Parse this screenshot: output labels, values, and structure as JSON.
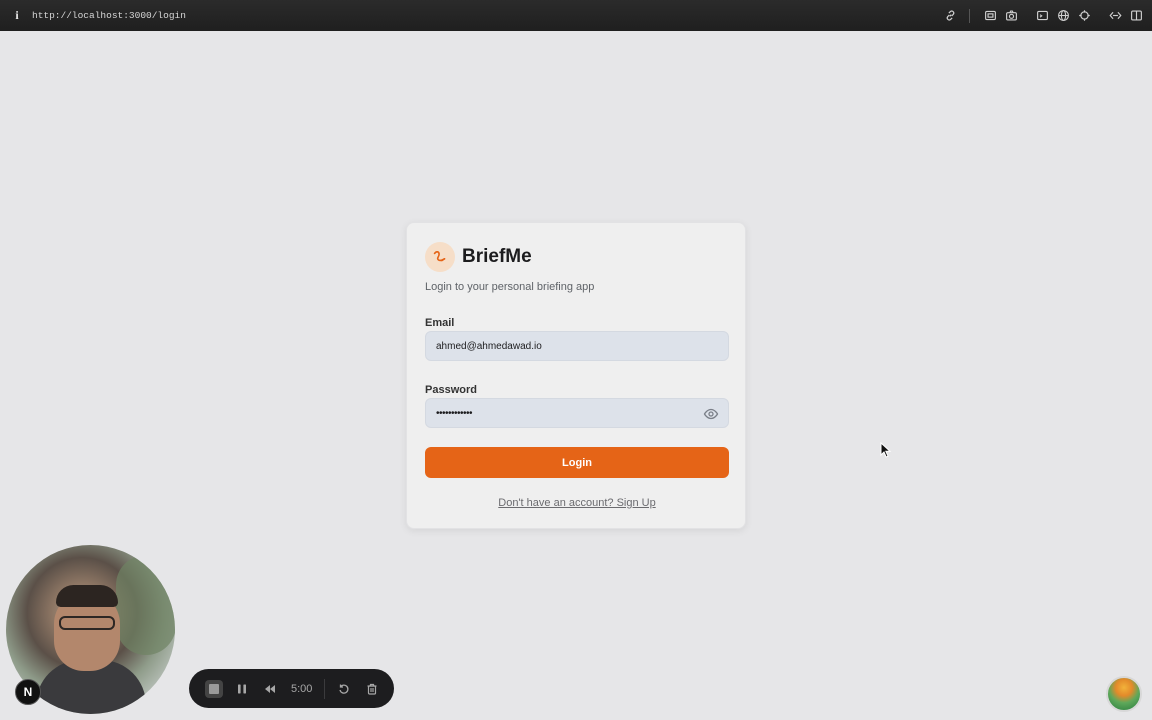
{
  "browser": {
    "info_icon": "i",
    "url": "http://localhost:3000/login",
    "toolbar_icons": [
      "link-icon",
      "screenshot-icon",
      "camera-icon",
      "console-icon",
      "globe-icon",
      "crosshair-icon",
      "code-icon",
      "split-view-icon"
    ]
  },
  "login_card": {
    "app_name": "BriefMe",
    "subtitle": "Login to your personal briefing app",
    "email": {
      "label": "Email",
      "value": "ahmed@ahmedawad.io"
    },
    "password": {
      "label": "Password",
      "value": "••••••••••••"
    },
    "login_label": "Login",
    "signup_link": "Don't have an account? Sign Up"
  },
  "recorder": {
    "time": "5:00",
    "badge": "N"
  },
  "colors": {
    "accent": "#e56417",
    "page_bg": "#e6e6e8",
    "card_bg": "#efefef",
    "input_bg": "#dde2ea"
  }
}
